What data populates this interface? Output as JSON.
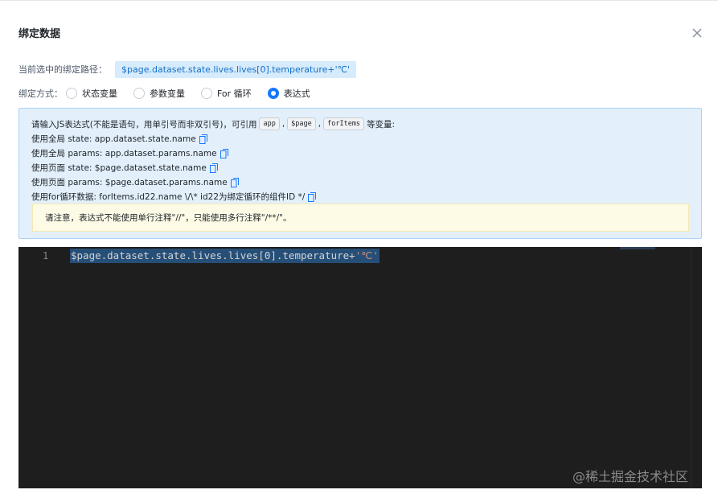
{
  "dialog": {
    "title": "绑定数据"
  },
  "binding_path": {
    "label": "当前选中的绑定路径：",
    "value": "$page.dataset.state.lives.lives[0].temperature+'℃'"
  },
  "binding_mode": {
    "label": "绑定方式：",
    "options": [
      {
        "label": "状态变量",
        "checked": false
      },
      {
        "label": "参数变量",
        "checked": false
      },
      {
        "label": "For 循环",
        "checked": false
      },
      {
        "label": "表达式",
        "checked": true
      }
    ]
  },
  "info": {
    "intro_prefix": "请输入JS表达式(不能是语句，用单引号而非双引号)，可引用",
    "chips": [
      "app",
      "$page",
      "forItems"
    ],
    "intro_suffix": "等变量:",
    "examples": [
      "使用全局 state: app.dataset.state.name",
      "使用全局 params: app.dataset.params.name",
      "使用页面 state: $page.dataset.state.name",
      "使用页面 params: $page.dataset.params.name",
      "使用for循环数据: forItems.id22.name \\/\\* id22为绑定循环的组件ID */"
    ],
    "warning": "请注意，表达式不能使用单行注释\"//\"，只能使用多行注释\"/**/\"。"
  },
  "editor": {
    "line_number": "1",
    "code_main": "$page.dataset.state.lives.lives[0].temperature+",
    "code_string": "'℃'"
  },
  "watermark": "@稀土掘金技术社区",
  "colors": {
    "accent": "#1677ff",
    "path_tag_bg": "#d6ebfb",
    "info_bg": "#e3f0fc",
    "warn_bg": "#fdfbe6",
    "editor_bg": "#1e1e1e"
  }
}
